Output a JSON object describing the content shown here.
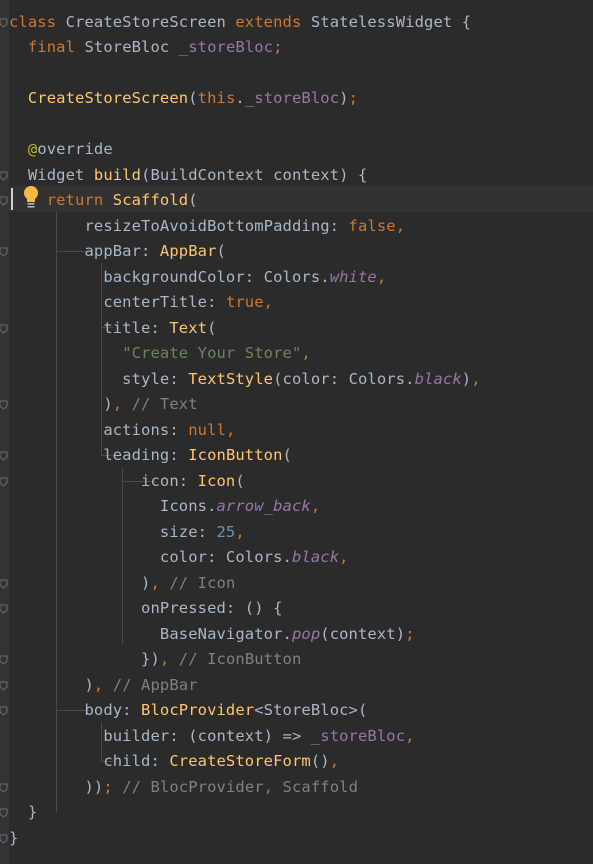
{
  "editor": {
    "theme": {
      "background": "#2b2b2b",
      "keyword": "#cc7832",
      "function": "#ffc66d",
      "string": "#6a8759",
      "number": "#6897bb",
      "comment": "#808080",
      "field": "#9876aa",
      "annotation": "#bbb529",
      "text": "#a9b7c6"
    },
    "icons": {
      "intention_bulb": "lightbulb-icon",
      "fold_marker": "fold-marker-icon"
    },
    "caret_line": 8,
    "lines": [
      [
        {
          "t": "kw",
          "s": "class "
        },
        {
          "t": "plain",
          "s": "CreateStoreScreen "
        },
        {
          "t": "kw",
          "s": "extends "
        },
        {
          "t": "plain",
          "s": "StatelessWidget {"
        }
      ],
      [
        {
          "t": "plain",
          "s": "  "
        },
        {
          "t": "kw",
          "s": "final "
        },
        {
          "t": "plain",
          "s": "StoreBloc "
        },
        {
          "t": "fld",
          "s": "_storeBloc"
        },
        {
          "t": "kw",
          "s": ";"
        }
      ],
      [],
      [
        {
          "t": "plain",
          "s": "  "
        },
        {
          "t": "fn",
          "s": "CreateStoreScreen"
        },
        {
          "t": "plain",
          "s": "("
        },
        {
          "t": "kw",
          "s": "this"
        },
        {
          "t": "plain",
          "s": "."
        },
        {
          "t": "fld",
          "s": "_storeBloc"
        },
        {
          "t": "plain",
          "s": ")"
        },
        {
          "t": "kw",
          "s": ";"
        }
      ],
      [],
      [
        {
          "t": "plain",
          "s": "  "
        },
        {
          "t": "ann",
          "s": "@"
        },
        {
          "t": "plain",
          "s": "override"
        }
      ],
      [
        {
          "t": "plain",
          "s": "  Widget "
        },
        {
          "t": "fn",
          "s": "build"
        },
        {
          "t": "plain",
          "s": "(BuildContext context) {"
        }
      ],
      [
        {
          "t": "plain",
          "s": "    "
        },
        {
          "t": "kw",
          "s": "return "
        },
        {
          "t": "fn",
          "s": "Scaffold"
        },
        {
          "t": "plain",
          "s": "("
        }
      ],
      [
        {
          "t": "plain",
          "s": "        resizeToAvoidBottomPadding: "
        },
        {
          "t": "kw",
          "s": "false,"
        }
      ],
      [
        {
          "t": "plain",
          "s": "        appBar: "
        },
        {
          "t": "fn",
          "s": "AppBar"
        },
        {
          "t": "plain",
          "s": "("
        }
      ],
      [
        {
          "t": "plain",
          "s": "          backgroundColor: Colors."
        },
        {
          "t": "it",
          "s": "white"
        },
        {
          "t": "kw",
          "s": ","
        }
      ],
      [
        {
          "t": "plain",
          "s": "          centerTitle: "
        },
        {
          "t": "kw",
          "s": "true,"
        }
      ],
      [
        {
          "t": "plain",
          "s": "          title: "
        },
        {
          "t": "fn",
          "s": "Text"
        },
        {
          "t": "plain",
          "s": "("
        }
      ],
      [
        {
          "t": "plain",
          "s": "            "
        },
        {
          "t": "str",
          "s": "\"Create Your Store\""
        },
        {
          "t": "kw",
          "s": ","
        }
      ],
      [
        {
          "t": "plain",
          "s": "            style: "
        },
        {
          "t": "fn",
          "s": "TextStyle"
        },
        {
          "t": "plain",
          "s": "(color: Colors."
        },
        {
          "t": "it",
          "s": "black"
        },
        {
          "t": "plain",
          "s": ")"
        },
        {
          "t": "kw",
          "s": ","
        }
      ],
      [
        {
          "t": "plain",
          "s": "          )"
        },
        {
          "t": "kw",
          "s": ", "
        },
        {
          "t": "cmt",
          "s": "// Text"
        }
      ],
      [
        {
          "t": "plain",
          "s": "          actions: "
        },
        {
          "t": "kw",
          "s": "null,"
        }
      ],
      [
        {
          "t": "plain",
          "s": "          leading: "
        },
        {
          "t": "fn",
          "s": "IconButton"
        },
        {
          "t": "plain",
          "s": "("
        }
      ],
      [
        {
          "t": "plain",
          "s": "              icon: "
        },
        {
          "t": "fn",
          "s": "Icon"
        },
        {
          "t": "plain",
          "s": "("
        }
      ],
      [
        {
          "t": "plain",
          "s": "                Icons."
        },
        {
          "t": "it",
          "s": "arrow_back"
        },
        {
          "t": "kw",
          "s": ","
        }
      ],
      [
        {
          "t": "plain",
          "s": "                size: "
        },
        {
          "t": "num",
          "s": "25"
        },
        {
          "t": "kw",
          "s": ","
        }
      ],
      [
        {
          "t": "plain",
          "s": "                color: Colors."
        },
        {
          "t": "it",
          "s": "black"
        },
        {
          "t": "kw",
          "s": ","
        }
      ],
      [
        {
          "t": "plain",
          "s": "              )"
        },
        {
          "t": "kw",
          "s": ", "
        },
        {
          "t": "cmt",
          "s": "// Icon"
        }
      ],
      [
        {
          "t": "plain",
          "s": "              onPressed: () {"
        }
      ],
      [
        {
          "t": "plain",
          "s": "                BaseNavigator."
        },
        {
          "t": "it",
          "s": "pop"
        },
        {
          "t": "plain",
          "s": "(context)"
        },
        {
          "t": "kw",
          "s": ";"
        }
      ],
      [
        {
          "t": "plain",
          "s": "              })"
        },
        {
          "t": "kw",
          "s": ", "
        },
        {
          "t": "cmt",
          "s": "// IconButton"
        }
      ],
      [
        {
          "t": "plain",
          "s": "        )"
        },
        {
          "t": "kw",
          "s": ", "
        },
        {
          "t": "cmt",
          "s": "// AppBar"
        }
      ],
      [
        {
          "t": "plain",
          "s": "        body: "
        },
        {
          "t": "fn",
          "s": "BlocProvider"
        },
        {
          "t": "plain",
          "s": "<StoreBloc>("
        }
      ],
      [
        {
          "t": "plain",
          "s": "          builder: (context) => "
        },
        {
          "t": "fld",
          "s": "_storeBloc"
        },
        {
          "t": "kw",
          "s": ","
        }
      ],
      [
        {
          "t": "plain",
          "s": "          child: "
        },
        {
          "t": "fn",
          "s": "CreateStoreForm"
        },
        {
          "t": "plain",
          "s": "()"
        },
        {
          "t": "kw",
          "s": ","
        }
      ],
      [
        {
          "t": "plain",
          "s": "        ))"
        },
        {
          "t": "kw",
          "s": "; "
        },
        {
          "t": "cmt",
          "s": "// BlocProvider, Scaffold"
        }
      ],
      [
        {
          "t": "plain",
          "s": "  }"
        }
      ],
      [
        {
          "t": "plain",
          "s": "}"
        }
      ]
    ]
  }
}
